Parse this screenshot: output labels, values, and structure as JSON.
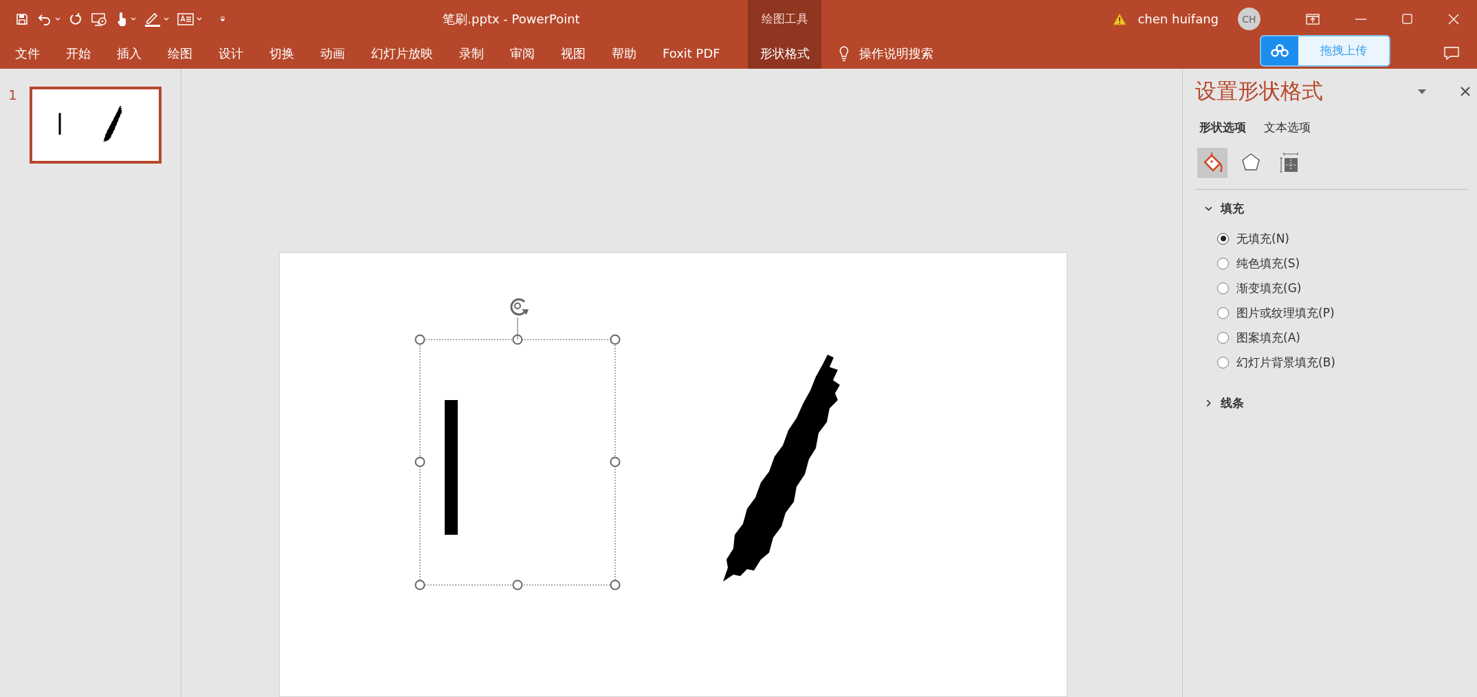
{
  "window": {
    "title": "笔刷.pptx  -  PowerPoint",
    "user": "chen huifang",
    "avatar": "CH"
  },
  "contextual_group": "绘图工具",
  "ribbon_tabs": [
    {
      "label": "文件",
      "selected": false
    },
    {
      "label": "开始",
      "selected": false
    },
    {
      "label": "插入",
      "selected": false
    },
    {
      "label": "绘图",
      "selected": false
    },
    {
      "label": "设计",
      "selected": false
    },
    {
      "label": "切换",
      "selected": false
    },
    {
      "label": "动画",
      "selected": false
    },
    {
      "label": "幻灯片放映",
      "selected": false
    },
    {
      "label": "录制",
      "selected": false
    },
    {
      "label": "审阅",
      "selected": false
    },
    {
      "label": "视图",
      "selected": false
    },
    {
      "label": "帮助",
      "selected": false
    },
    {
      "label": "Foxit PDF",
      "selected": false
    }
  ],
  "contextual_tab": {
    "label": "形状格式",
    "selected": true
  },
  "tell_me": "操作说明搜索",
  "upload_button": "拖拽上传",
  "slides": [
    {
      "number": "1",
      "selected": true
    }
  ],
  "format_pane": {
    "title": "设置形状格式",
    "tabs": [
      {
        "label": "形状选项",
        "selected": true
      },
      {
        "label": "文本选项",
        "selected": false
      }
    ],
    "icon_tabs": [
      {
        "kind": "fill",
        "selected": true
      },
      {
        "kind": "effects",
        "selected": false
      },
      {
        "kind": "size",
        "selected": false
      }
    ],
    "sections": [
      {
        "label": "填充",
        "expanded": true,
        "options": [
          {
            "label": "无填充(N)",
            "selected": true
          },
          {
            "label": "纯色填充(S)",
            "selected": false
          },
          {
            "label": "渐变填充(G)",
            "selected": false
          },
          {
            "label": "图片或纹理填充(P)",
            "selected": false
          },
          {
            "label": "图案填充(A)",
            "selected": false
          },
          {
            "label": "幻灯片背景填充(B)",
            "selected": false
          }
        ]
      },
      {
        "label": "线条",
        "expanded": false
      }
    ]
  }
}
